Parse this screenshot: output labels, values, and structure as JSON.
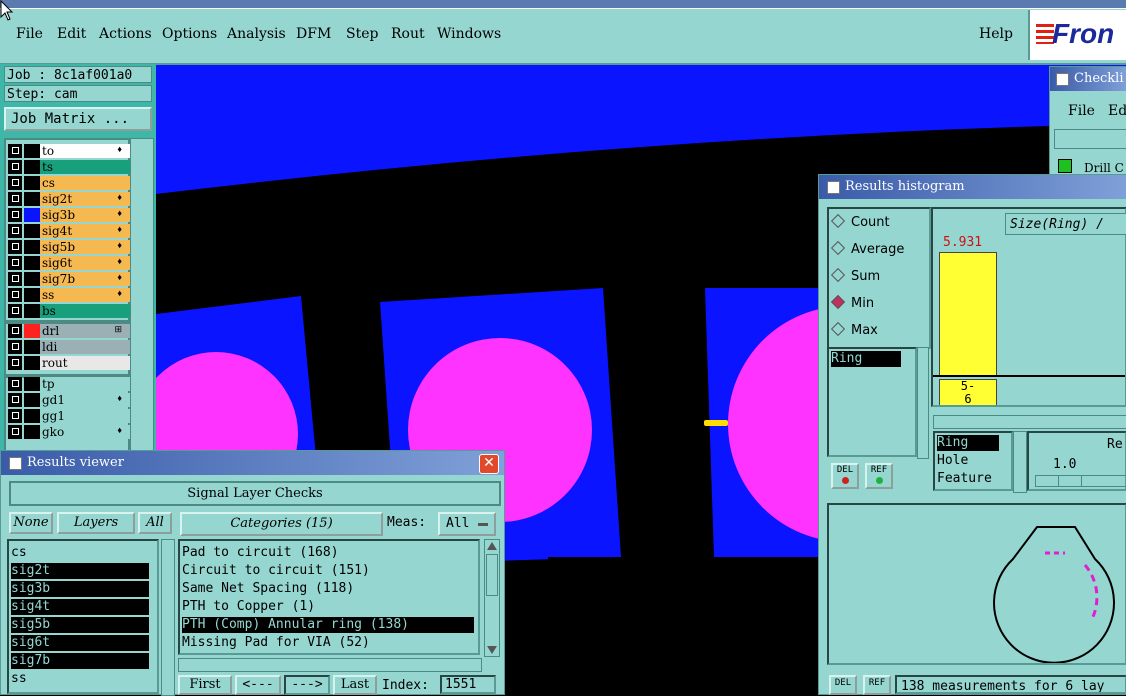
{
  "menubar": {
    "items": [
      "File",
      "Edit",
      "Actions",
      "Options",
      "Analysis",
      "DFM",
      "Step",
      "Rout",
      "Windows"
    ],
    "help": "Help",
    "logo": "Fron"
  },
  "job": {
    "job_label": "Job : 8c1af001a0",
    "step_label": "Step: cam",
    "matrix_button": "Job Matrix ..."
  },
  "layers_group1": [
    {
      "name": "to",
      "color": "#ffffff",
      "mark": "♦"
    },
    {
      "name": "ts",
      "color": "#18a07c",
      "mark": ""
    },
    {
      "name": "cs",
      "color": "#f6b850",
      "mark": ""
    },
    {
      "name": "sig2t",
      "color": "#f6b850",
      "mark": "♦"
    },
    {
      "name": "sig3b",
      "color": "#f6b850",
      "mark": "♦"
    },
    {
      "name": "sig4t",
      "color": "#f6b850",
      "mark": "♦"
    },
    {
      "name": "sig5b",
      "color": "#f6b850",
      "mark": "♦"
    },
    {
      "name": "sig6t",
      "color": "#f6b850",
      "mark": "♦"
    },
    {
      "name": "sig7b",
      "color": "#f6b850",
      "mark": "♦"
    },
    {
      "name": "ss",
      "color": "#f6b850",
      "mark": "♦"
    },
    {
      "name": "bs",
      "color": "#18a07c",
      "mark": ""
    }
  ],
  "layers_group2": [
    {
      "name": "drl",
      "color": "#9ab0b4",
      "mark": "⊞"
    },
    {
      "name": "ldi",
      "color": "#9ab0b4",
      "mark": ""
    },
    {
      "name": "rout",
      "color": "#e8e8e8",
      "mark": ""
    }
  ],
  "layers_group3": [
    {
      "name": "tp",
      "color": "#96d6d0",
      "mark": ""
    },
    {
      "name": "gd1",
      "color": "#96d6d0",
      "mark": "♦"
    },
    {
      "name": "gg1",
      "color": "#96d6d0",
      "mark": ""
    },
    {
      "name": "gko",
      "color": "#96d6d0",
      "mark": "♦"
    }
  ],
  "results_viewer": {
    "title": "Results viewer",
    "group_title": "Signal Layer Checks",
    "none_button": "None",
    "layers_button": "Layers",
    "all_button": "All",
    "categories_button": "Categories (15)",
    "meas_label": "Meas:",
    "meas_value": "All",
    "layers": [
      {
        "name": "cs",
        "selected": false
      },
      {
        "name": "sig2t",
        "selected": true
      },
      {
        "name": "sig3b",
        "selected": true
      },
      {
        "name": "sig4t",
        "selected": true
      },
      {
        "name": "sig5b",
        "selected": true
      },
      {
        "name": "sig6t",
        "selected": true
      },
      {
        "name": "sig7b",
        "selected": true
      },
      {
        "name": "ss",
        "selected": false
      }
    ],
    "categories": [
      {
        "text": "Pad to circuit (168)",
        "selected": false
      },
      {
        "text": "Circuit to circuit (151)",
        "selected": false
      },
      {
        "text": "Same Net Spacing (118)",
        "selected": false
      },
      {
        "text": "PTH to Copper (1)",
        "selected": false
      },
      {
        "text": "PTH (Comp) Annular ring (138)",
        "selected": true
      },
      {
        "text": "Missing Pad for VIA (52)",
        "selected": false
      }
    ],
    "first_button": "First",
    "prev_button": "<---",
    "next_button": "--->",
    "last_button": "Last",
    "index_label": "Index:",
    "index_value": "1551"
  },
  "checklist": {
    "title": "Checkli",
    "file_menu": "File",
    "edit_menu": "Edi",
    "item": "Drill C"
  },
  "histogram": {
    "title": "Results histogram",
    "modes": [
      {
        "label": "Count",
        "selected": false
      },
      {
        "label": "Average",
        "selected": false
      },
      {
        "label": "Sum",
        "selected": false
      },
      {
        "label": "Min",
        "selected": true
      },
      {
        "label": "Max",
        "selected": false
      }
    ],
    "attribute_list": [
      "Ring"
    ],
    "del_button": "DEL",
    "ref_button": "REF",
    "size_label": "Size(Ring) / ",
    "bar_value": "5.931",
    "bar_bin_top": "5-",
    "bar_bin_bottom": "6",
    "bar_fill_fraction": 0.88,
    "measure_list": [
      "Ring",
      "Hole",
      "Feature"
    ],
    "re_label": "Re",
    "re_value": "1.0",
    "status_text": "138 measurements for 6 lay"
  }
}
